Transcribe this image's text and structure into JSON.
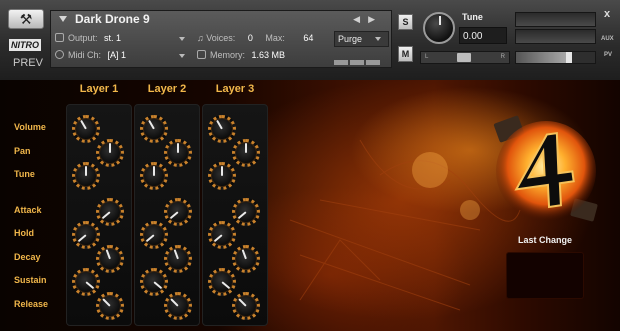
{
  "header": {
    "instrument_name": "Dark Drone 9",
    "brand_logo_text": "NITRO",
    "prev_label": "PREV",
    "output_label": "Output:",
    "output_value": "st. 1",
    "midi_label": "Midi Ch:",
    "midi_value": "[A] 1",
    "voices_label": "Voices:",
    "voices_value": "0",
    "max_label": "Max:",
    "max_value": "64",
    "memory_label": "Memory:",
    "memory_value": "1.63 MB",
    "purge_label": "Purge",
    "solo_label": "S",
    "mute_label": "M",
    "tune_label": "Tune",
    "tune_value": "0.00",
    "pan_left": "L",
    "pan_right": "R",
    "close_label": "x",
    "aux_label": "AUX",
    "pv_label": "PV"
  },
  "layers": [
    {
      "title": "Layer 1"
    },
    {
      "title": "Layer 2"
    },
    {
      "title": "Layer 3"
    }
  ],
  "params": [
    "Volume",
    "Pan",
    "Tune",
    "Attack",
    "Hold",
    "Decay",
    "Sustain",
    "Release"
  ],
  "last_change": {
    "title": "Last Change",
    "value": ""
  },
  "icons": {
    "wrench": "wrench-icon",
    "brand": "nitro-logo",
    "product_badge": "flame-badge-logo"
  },
  "colors": {
    "label_orange": "#f0b64a",
    "knob_ring": "#c9822c",
    "background_glow": "#e07a1a"
  }
}
